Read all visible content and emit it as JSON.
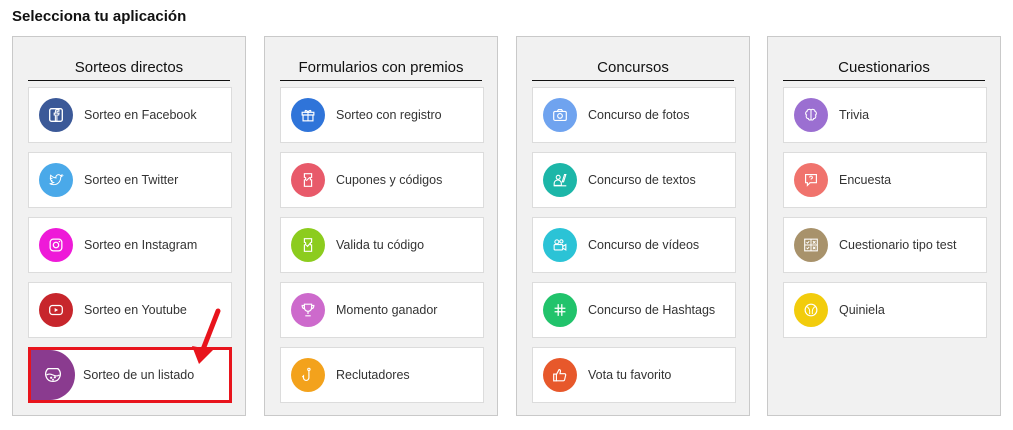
{
  "page": {
    "title": "Selecciona tu aplicación"
  },
  "colors": {
    "highlight_border": "#e8141c",
    "arrow": "#e8141c"
  },
  "columns": [
    {
      "title": "Sorteos directos",
      "items": [
        {
          "label": "Sorteo en Facebook",
          "icon": "facebook-icon",
          "color": "#3b5998"
        },
        {
          "label": "Sorteo en Twitter",
          "icon": "twitter-icon",
          "color": "#4aa9e9"
        },
        {
          "label": "Sorteo en Instagram",
          "icon": "instagram-icon",
          "color": "#ee1ad8"
        },
        {
          "label": "Sorteo en Youtube",
          "icon": "youtube-icon",
          "color": "#c7262c"
        },
        {
          "label": "Sorteo de un listado",
          "icon": "fishbowl-icon",
          "color": "#8a3b8f"
        }
      ]
    },
    {
      "title": "Formularios con premios",
      "items": [
        {
          "label": "Sorteo con registro",
          "icon": "gift-icon",
          "color": "#2f74d9"
        },
        {
          "label": "Cupones y códigos",
          "icon": "coupon-icon",
          "color": "#e85a6a"
        },
        {
          "label": "Valida tu código",
          "icon": "ticket-icon",
          "color": "#8ccc1e"
        },
        {
          "label": "Momento ganador",
          "icon": "trophy-icon",
          "color": "#cd6acc"
        },
        {
          "label": "Reclutadores",
          "icon": "hook-icon",
          "color": "#f3a21c"
        }
      ]
    },
    {
      "title": "Concursos",
      "items": [
        {
          "label": "Concurso de fotos",
          "icon": "camera-icon",
          "color": "#6fa3ef"
        },
        {
          "label": "Concurso de textos",
          "icon": "writing-icon",
          "color": "#1cb6a8"
        },
        {
          "label": "Concurso de vídeos",
          "icon": "video-camera-icon",
          "color": "#2bc3d6"
        },
        {
          "label": "Concurso de Hashtags",
          "icon": "hashtag-icon",
          "color": "#21c36b"
        },
        {
          "label": "Vota tu favorito",
          "icon": "thumbs-up-icon",
          "color": "#e7582b"
        }
      ]
    },
    {
      "title": "Cuestionarios",
      "items": [
        {
          "label": "Trivia",
          "icon": "brain-icon",
          "color": "#9b6fd1"
        },
        {
          "label": "Encuesta",
          "icon": "question-bubble-icon",
          "color": "#f0736d"
        },
        {
          "label": "Cuestionario tipo test",
          "icon": "checklist-icon",
          "color": "#a8926b"
        },
        {
          "label": "Quiniela",
          "icon": "ball-icon",
          "color": "#f2cc0c"
        }
      ]
    }
  ]
}
